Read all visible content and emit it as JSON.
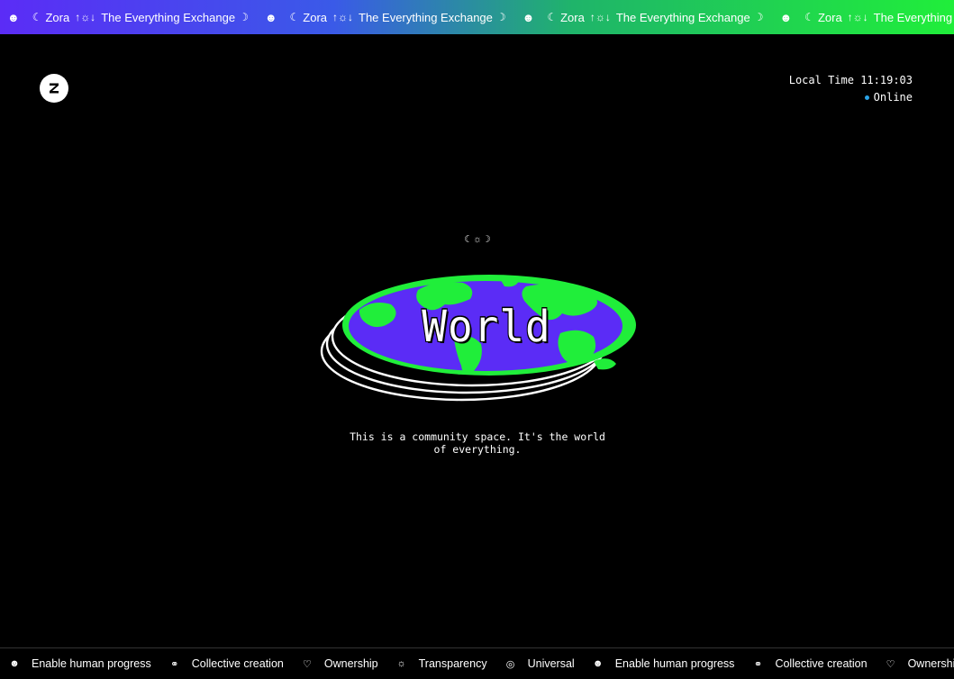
{
  "top_banner": {
    "segments": [
      {
        "smile": "☻",
        "moon_left": "☾",
        "brand": "Zora",
        "glyphs": "↑☼↓",
        "tagline": "The Everything Exchange",
        "moon_right": "☽"
      },
      {
        "smile": "☻",
        "moon_left": "☾",
        "brand": "Zora",
        "glyphs": "↑☼↓",
        "tagline": "The Everything Exchange",
        "moon_right": "☽"
      },
      {
        "smile": "☻",
        "moon_left": "☾",
        "brand": "Zora",
        "glyphs": "↑☼↓",
        "tagline": "The Everything Exchange",
        "moon_right": "☽"
      },
      {
        "smile": "☻",
        "moon_left": "☾",
        "brand": "Zora",
        "glyphs": "↑☼↓",
        "tagline": "The Everything Exchange",
        "moon_right": "☽"
      }
    ]
  },
  "header": {
    "logo_icon": "zora-logo-icon",
    "local_time_label": "Local Time",
    "local_time_value": "11:19:03",
    "status": "Online",
    "status_color": "#2aa3e6"
  },
  "hero": {
    "glyph_mark": "☾☼☽",
    "title": "World",
    "description_line1": "This is a community space. It's the world",
    "description_line2": "of everything.",
    "colors": {
      "ocean": "#5b2cf6",
      "land": "#20ee3a",
      "rings": "#ffffff"
    }
  },
  "bottom_bar": {
    "items": [
      {
        "icon": "☻",
        "label": "Enable human progress"
      },
      {
        "icon": "⚭",
        "label": "Collective creation"
      },
      {
        "icon": "♡",
        "label": "Ownership"
      },
      {
        "icon": "☼",
        "label": "Transparency"
      },
      {
        "icon": "◎",
        "label": "Universal"
      },
      {
        "icon": "☻",
        "label": "Enable human progress"
      },
      {
        "icon": "⚭",
        "label": "Collective creation"
      },
      {
        "icon": "♡",
        "label": "Ownership"
      }
    ]
  }
}
